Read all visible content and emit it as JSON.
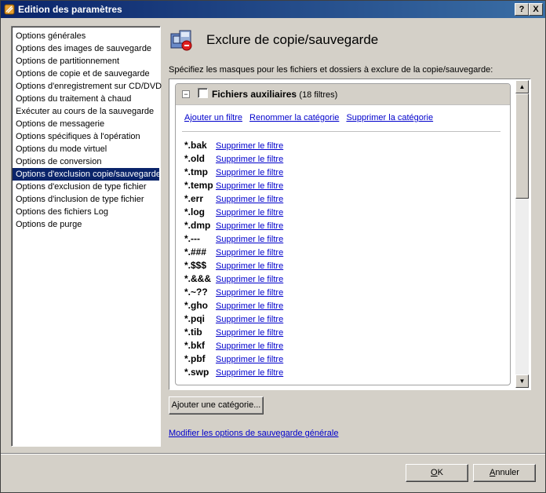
{
  "window": {
    "title": "Edition des paramètres",
    "help_label": "?",
    "close_label": "X"
  },
  "sidebar": {
    "items": [
      {
        "label": "Options générales"
      },
      {
        "label": "Options des images de sauvegarde"
      },
      {
        "label": "Options de partitionnement"
      },
      {
        "label": "Options de copie et de sauvegarde"
      },
      {
        "label": "Options d'enregistrement sur CD/DVD"
      },
      {
        "label": "Options du traitement à chaud"
      },
      {
        "label": "Exécuter au cours de la sauvegarde"
      },
      {
        "label": "Options de messagerie"
      },
      {
        "label": "Options spécifiques à l'opération"
      },
      {
        "label": "Options du mode virtuel"
      },
      {
        "label": "Options de conversion"
      },
      {
        "label": "Options d'exclusion copie/sauvegarde",
        "selected": true
      },
      {
        "label": "Options d'exclusion de type fichier"
      },
      {
        "label": "Options d'inclusion de type fichier"
      },
      {
        "label": "Options des fichiers Log"
      },
      {
        "label": "Options de purge"
      }
    ]
  },
  "main": {
    "title": "Exclure de copie/sauvegarde",
    "instruction": "Spécifiez les masques pour les fichiers et dossiers à exclure de la copie/sauvegarde:",
    "category": {
      "name": "Fichiers auxiliaires",
      "count": "(18 filtres)",
      "expand_glyph": "−",
      "actions": {
        "add_filter": "Ajouter un filtre",
        "rename": "Renommer la catégorie",
        "delete": "Supprimer la catégorie"
      },
      "remove_label": "Supprimer le filtre",
      "filters": [
        "*.bak",
        "*.old",
        "*.tmp",
        "*.temp",
        "*.err",
        "*.log",
        "*.dmp",
        "*.---",
        "*.###",
        "*.$$$",
        "*.&&&",
        "*.~??",
        "*.gho",
        "*.pqi",
        "*.tib",
        "*.bkf",
        "*.pbf",
        "*.swp"
      ]
    },
    "add_category_label": "Ajouter une catégorie...",
    "modify_link": "Modifier les options de sauvegarde générale"
  },
  "footer": {
    "ok_accel": "O",
    "ok_rest": "K",
    "cancel_accel": "A",
    "cancel_rest": "nnuler"
  },
  "colors": {
    "selection": "#0a246a",
    "link": "#0000cc",
    "face": "#d4d0c8"
  }
}
